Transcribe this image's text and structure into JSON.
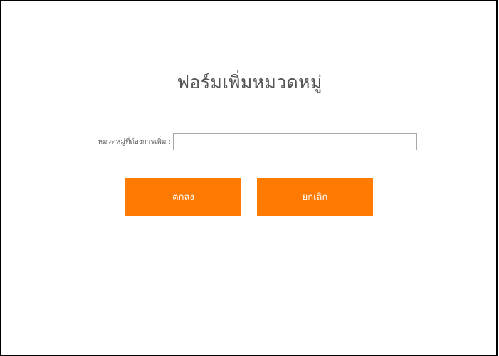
{
  "form": {
    "title": "ฟอร์มเพิ่มหมวดหมู่",
    "category_label": "หมวดหมู่ที่ต้องการเพิ่ม :",
    "category_value": "",
    "category_placeholder": ""
  },
  "buttons": {
    "ok_label": "ตกลง",
    "cancel_label": "ยกเลิก"
  },
  "colors": {
    "button_bg": "#ff7a00",
    "button_text": "#ffffff",
    "title_text": "#555555",
    "border": "#000000"
  }
}
